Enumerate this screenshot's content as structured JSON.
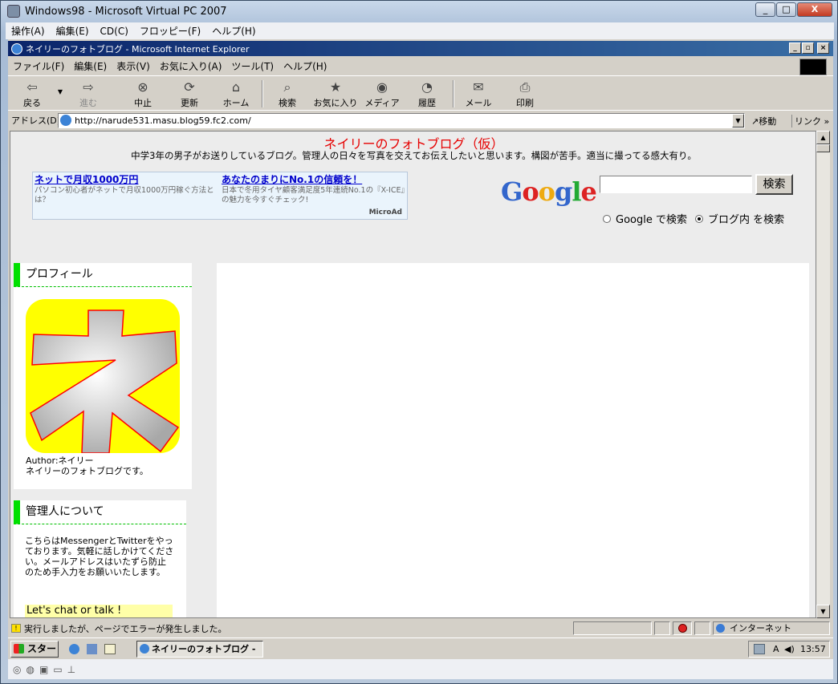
{
  "host": {
    "title": "Windows98 - Microsoft Virtual PC 2007",
    "menu": [
      "操作(A)",
      "編集(E)",
      "CD(C)",
      "フロッピー(F)",
      "ヘルプ(H)"
    ]
  },
  "ie": {
    "title": "ネイリーのフォトブログ - Microsoft Internet Explorer",
    "menu": [
      "ファイル(F)",
      "編集(E)",
      "表示(V)",
      "お気に入り(A)",
      "ツール(T)",
      "ヘルプ(H)"
    ],
    "toolbar": {
      "back": "戻る",
      "forward": "進む",
      "stop": "中止",
      "refresh": "更新",
      "home": "ホーム",
      "search": "検索",
      "favorites": "お気に入り",
      "media": "メディア",
      "history": "履歴",
      "mail": "メール",
      "print": "印刷"
    },
    "address_label": "アドレス(D)",
    "url": "http://narude531.masu.blog59.fc2.com/",
    "go": "移動",
    "links": "リンク"
  },
  "page": {
    "title": "ネイリーのフォトブログ（仮）",
    "description": "中学3年の男子がお送りしているブログ。管理人の日々を写真を交えてお伝えしたいと思います。構図が苦手。適当に撮ってる感大有り。",
    "ads": [
      {
        "title": "ネットで月収1000万円",
        "text": "パソコン初心者がネットで月収1000万円稼ぐ方法とは？"
      },
      {
        "title": "あなたのまりにNo.1の信頼を！",
        "text": "日本で冬用タイヤ顧客満足度5年連続No.1の『X-ICE』の魅力を今すぐチェック!"
      }
    ],
    "ad_brand": "MicroAd",
    "google": {
      "logo": "Google",
      "button": "検索",
      "option_web": "Google で検索",
      "option_blog": "ブログ内 を検索",
      "selected": "blog"
    },
    "profile": {
      "heading": "プロフィール",
      "logo_char": "ネ",
      "author": "Author:ネイリー",
      "bio": "ネイリーのフォトブログです。"
    },
    "about": {
      "heading": "管理人について",
      "text": "こちらはMessengerとTwitterをやっております。気軽に話しかけてください。メールアドレスはいたずら防止のため手入力をお願いいたします。",
      "chat": "Let's chat or talk !"
    }
  },
  "status": {
    "message": "実行しましたが、ページでエラーが発生しました。",
    "zone": "インターネット"
  },
  "taskbar": {
    "start": "スタート",
    "task": "ネイリーのフォトブログ - ...",
    "tray_ime": "A",
    "clock": "13:57"
  },
  "colors": {
    "title_red": "#e60000",
    "accent_green": "#00e000",
    "ie_title_bar": "#0a246a",
    "logo_yellow": "#ffff00"
  }
}
